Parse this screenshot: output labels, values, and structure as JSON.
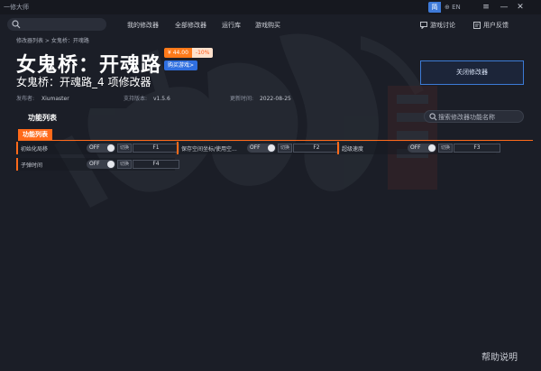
{
  "app": {
    "name": "一修大师",
    "lang_cn": "简",
    "lang_en": "EN"
  },
  "search": {
    "placeholder": ""
  },
  "nav": {
    "items": [
      "我的修改器",
      "全部修改器",
      "运行库",
      "游戏购买"
    ],
    "game_discussion": "游戏讨论",
    "user_feedback": "用户反馈"
  },
  "breadcrumb": "修改器列表 > 女鬼桥：开魂路",
  "game": {
    "title": "女鬼桥：开魂路",
    "price": "¥ 44.00",
    "discount": "-10%",
    "buy_label": "购买游戏>",
    "trainer_title": "女鬼桥：开魂路_4 项修改器",
    "publisher_label": "发布者:",
    "publisher": "Xiumaster",
    "version_label": "支持版本:",
    "version": "v1.5.6",
    "updated_label": "更新时间:",
    "updated": "2022-08-25"
  },
  "close_trainer_label": "关闭修改器",
  "features_heading": "功能列表",
  "feature_search_placeholder": "搜索修改器功能名称",
  "tab_label": "功能列表",
  "features": [
    {
      "name": "初始化局移",
      "toggle": "OFF",
      "hotkey_label": "切换",
      "hotkey": "F1"
    },
    {
      "name": "保存空间坐标/使用空...",
      "toggle": "OFF",
      "hotkey_label": "切换",
      "hotkey": "F2"
    },
    {
      "name": "超级速度",
      "toggle": "OFF",
      "hotkey_label": "切换",
      "hotkey": "F3"
    },
    {
      "name": "子弹时间",
      "toggle": "OFF",
      "hotkey_label": "切换",
      "hotkey": "F4"
    }
  ],
  "help_label": "帮助说明",
  "colors": {
    "accent": "#ff6a1a",
    "primary": "#3c7bd6",
    "background": "#1b1e27"
  }
}
